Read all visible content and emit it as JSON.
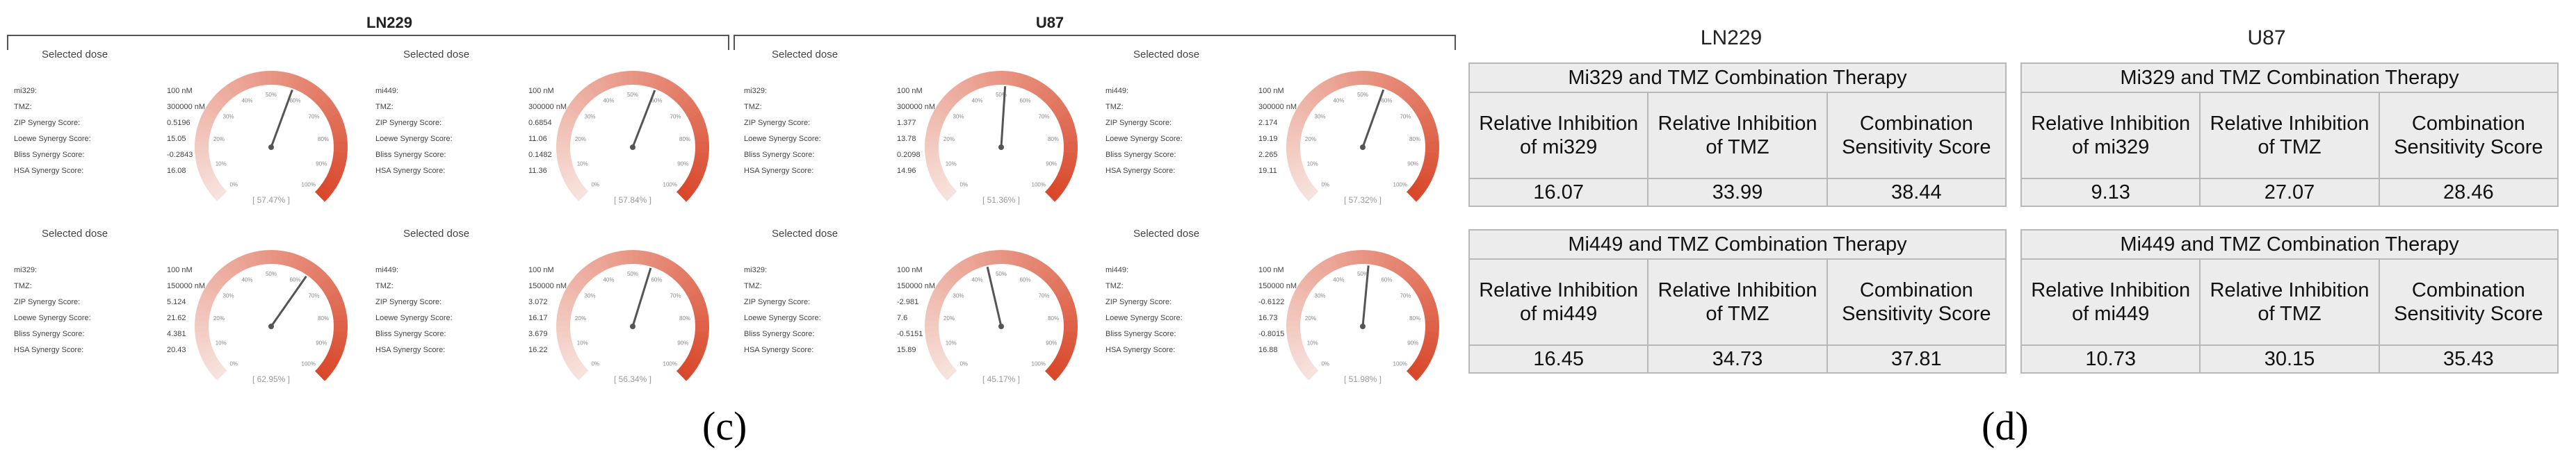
{
  "panel_c": {
    "groups": [
      {
        "title": "LN229"
      },
      {
        "title": "U87"
      }
    ],
    "cells": [
      {
        "title": "Selected dose",
        "params": [
          [
            "mi329:",
            "100 nM"
          ],
          [
            "TMZ:",
            "300000 nM"
          ],
          [
            "ZIP Synergy Score:",
            "0.5196"
          ],
          [
            "Loewe Synergy Score:",
            "15.05"
          ],
          [
            "Bliss Synergy Score:",
            "-0.2843"
          ],
          [
            "HSA Synergy Score:",
            "16.08"
          ]
        ],
        "gauge_label": "[ 57.47% ]",
        "value": 57.47
      },
      {
        "title": "Selected dose",
        "params": [
          [
            "mi449:",
            "100 nM"
          ],
          [
            "TMZ:",
            "300000 nM"
          ],
          [
            "ZIP Synergy Score:",
            "0.6854"
          ],
          [
            "Loewe Synergy Score:",
            "11.06"
          ],
          [
            "Bliss Synergy Score:",
            "0.1482"
          ],
          [
            "HSA Synergy Score:",
            "11.36"
          ]
        ],
        "gauge_label": "[ 57.84% ]",
        "value": 57.84
      },
      {
        "title": "Selected dose",
        "params": [
          [
            "mi329:",
            "100 nM"
          ],
          [
            "TMZ:",
            "300000 nM"
          ],
          [
            "ZIP Synergy Score:",
            "1.377"
          ],
          [
            "Loewe Synergy Score:",
            "13.78"
          ],
          [
            "Bliss Synergy Score:",
            "0.2098"
          ],
          [
            "HSA Synergy Score:",
            "14.96"
          ]
        ],
        "gauge_label": "[ 51.36% ]",
        "value": 51.36
      },
      {
        "title": "Selected dose",
        "params": [
          [
            "mi449:",
            "100 nM"
          ],
          [
            "TMZ:",
            "300000 nM"
          ],
          [
            "ZIP Synergy Score:",
            "2.174"
          ],
          [
            "Loewe Synergy Score:",
            "19.19"
          ],
          [
            "Bliss Synergy Score:",
            "2.265"
          ],
          [
            "HSA Synergy Score:",
            "19.11"
          ]
        ],
        "gauge_label": "[ 57.32% ]",
        "value": 57.32
      },
      {
        "title": "Selected dose",
        "params": [
          [
            "mi329:",
            "100 nM"
          ],
          [
            "TMZ:",
            "150000 nM"
          ],
          [
            "ZIP Synergy Score:",
            "5.124"
          ],
          [
            "Loewe Synergy Score:",
            "21.62"
          ],
          [
            "Bliss Synergy Score:",
            "4.381"
          ],
          [
            "HSA Synergy Score:",
            "20.43"
          ]
        ],
        "gauge_label": "[ 62.95% ]",
        "value": 62.95
      },
      {
        "title": "Selected dose",
        "params": [
          [
            "mi449:",
            "100 nM"
          ],
          [
            "TMZ:",
            "150000 nM"
          ],
          [
            "ZIP Synergy Score:",
            "3.072"
          ],
          [
            "Loewe Synergy Score:",
            "16.17"
          ],
          [
            "Bliss Synergy Score:",
            "3.679"
          ],
          [
            "HSA Synergy Score:",
            "16.22"
          ]
        ],
        "gauge_label": "[ 56.34% ]",
        "value": 56.34
      },
      {
        "title": "Selected dose",
        "params": [
          [
            "mi329:",
            "100 nM"
          ],
          [
            "TMZ:",
            "150000 nM"
          ],
          [
            "ZIP Synergy Score:",
            "-2.981"
          ],
          [
            "Loewe Synergy Score:",
            "7.6"
          ],
          [
            "Bliss Synergy Score:",
            "-0.5151"
          ],
          [
            "HSA Synergy Score:",
            "15.89"
          ]
        ],
        "gauge_label": "[ 45.17% ]",
        "value": 45.17
      },
      {
        "title": "Selected dose",
        "params": [
          [
            "mi449:",
            "100 nM"
          ],
          [
            "TMZ:",
            "150000 nM"
          ],
          [
            "ZIP Synergy Score:",
            "-0.6122"
          ],
          [
            "Loewe Synergy Score:",
            "16.73"
          ],
          [
            "Bliss Synergy Score:",
            "-0.8015"
          ],
          [
            "HSA Synergy Score:",
            "16.88"
          ]
        ],
        "gauge_label": "[ 51.98% ]",
        "value": 51.98
      }
    ],
    "ticks": [
      "0%",
      "10%",
      "20%",
      "30%",
      "40%",
      "50%",
      "60%",
      "70%",
      "80%",
      "90%",
      "100%"
    ],
    "label": "(c)"
  },
  "panel_d": {
    "groups": [
      {
        "title": "LN229"
      },
      {
        "title": "U87"
      }
    ],
    "tables": [
      {
        "therapy": "Mi329 and TMZ Combination Therapy",
        "headers": [
          "Relative Inhibition of mi329",
          "Relative Inhibition of TMZ",
          "Combination Sensitivity Score"
        ],
        "values": [
          "16.07",
          "33.99",
          "38.44"
        ]
      },
      {
        "therapy": "Mi329 and TMZ Combination Therapy",
        "headers": [
          "Relative Inhibition of mi329",
          "Relative Inhibition of TMZ",
          "Combination Sensitivity Score"
        ],
        "values": [
          "9.13",
          "27.07",
          "28.46"
        ]
      },
      {
        "therapy": "Mi449 and TMZ Combination Therapy",
        "headers": [
          "Relative Inhibition of mi449",
          "Relative Inhibition of TMZ",
          "Combination Sensitivity Score"
        ],
        "values": [
          "16.45",
          "34.73",
          "37.81"
        ]
      },
      {
        "therapy": "Mi449 and TMZ Combination Therapy",
        "headers": [
          "Relative Inhibition of mi449",
          "Relative Inhibition of TMZ",
          "Combination Sensitivity Score"
        ],
        "values": [
          "10.73",
          "30.15",
          "35.43"
        ]
      }
    ],
    "label": "(d)"
  },
  "colors": {
    "arc_end": "#d9482b",
    "arc_start": "#f7e3dd",
    "needle": "#555555"
  }
}
